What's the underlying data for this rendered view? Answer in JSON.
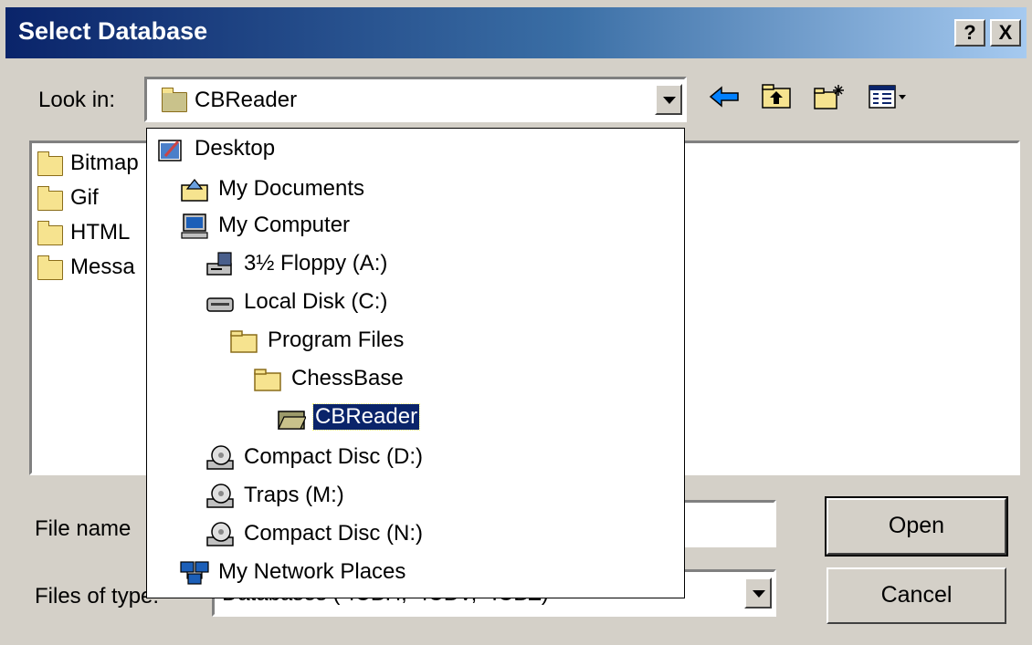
{
  "window": {
    "title": "Select Database",
    "help_label": "?",
    "close_label": "X"
  },
  "lookin": {
    "label": "Look in:",
    "value": "CBReader"
  },
  "file_list": [
    "Bitmap",
    "Gif",
    "HTML",
    "Messa"
  ],
  "dropdown_items": [
    {
      "label": "Desktop",
      "icon": "desktop-icon"
    },
    {
      "label": "My Documents",
      "icon": "my-documents-icon"
    },
    {
      "label": "My Computer",
      "icon": "my-computer-icon"
    },
    {
      "label": "3½ Floppy (A:)",
      "icon": "floppy-drive-icon"
    },
    {
      "label": "Local Disk (C:)",
      "icon": "hard-disk-icon"
    },
    {
      "label": "Program Files",
      "icon": "folder-icon"
    },
    {
      "label": "ChessBase",
      "icon": "folder-icon"
    },
    {
      "label": "CBReader",
      "icon": "open-folder-icon",
      "selected": true
    },
    {
      "label": "Compact Disc (D:)",
      "icon": "cd-drive-icon"
    },
    {
      "label": "Traps (M:)",
      "icon": "cd-drive-icon"
    },
    {
      "label": "Compact Disc (N:)",
      "icon": "cd-drive-icon"
    },
    {
      "label": "My Network Places",
      "icon": "network-places-icon"
    }
  ],
  "filename": {
    "label": "File name",
    "value": ""
  },
  "filetype": {
    "label": "Files of type:",
    "value": "Databases (*.CBH, *.CBV, *.CBZ)"
  },
  "buttons": {
    "open": "Open",
    "cancel": "Cancel"
  },
  "colors": {
    "title_start": "#0a246a",
    "title_end": "#a6caf0",
    "selection": "#0a246a",
    "face": "#d4d0c8"
  }
}
